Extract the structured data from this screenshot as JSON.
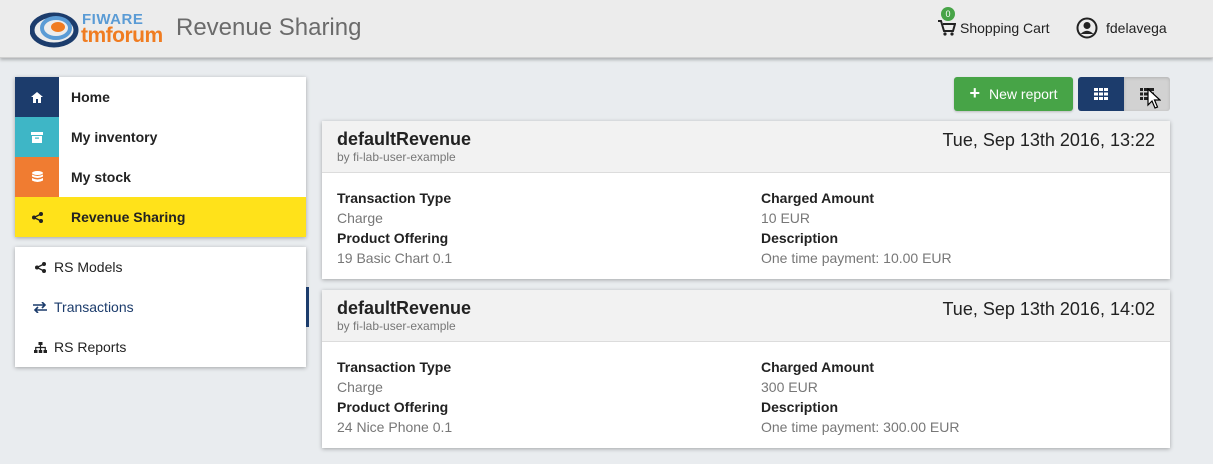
{
  "header": {
    "logo_top": "FIWARE",
    "logo_bottom": "tmforum",
    "title": "Revenue Sharing",
    "cart_count": "0",
    "cart_label": "Shopping Cart",
    "username": "fdelavega"
  },
  "sidebar": {
    "items": [
      {
        "label": "Home",
        "icon": "home-icon",
        "color": "#1c3c6c"
      },
      {
        "label": "My inventory",
        "icon": "archive-icon",
        "color": "#3eb6c6"
      },
      {
        "label": "My stock",
        "icon": "database-icon",
        "color": "#f07c31"
      },
      {
        "label": "Revenue Sharing",
        "icon": "share-icon",
        "color": "#ffe21a"
      }
    ]
  },
  "subnav": {
    "items": [
      {
        "label": "RS Models",
        "icon": "share-icon"
      },
      {
        "label": "Transactions",
        "icon": "exchange-icon"
      },
      {
        "label": "RS Reports",
        "icon": "sitemap-icon"
      }
    ]
  },
  "toolbar": {
    "new_report_label": "New report",
    "grid_view_icon": "grid-icon",
    "list_view_icon": "list-icon"
  },
  "reports": [
    {
      "title": "defaultRevenue",
      "subtitle": "by fi-lab-user-example",
      "date": "Tue, Sep 13th 2016, 13:22",
      "transaction_type_label": "Transaction Type",
      "transaction_type": "Charge",
      "product_offering_label": "Product Offering",
      "product_offering": "19 Basic Chart 0.1",
      "charged_amount_label": "Charged Amount",
      "charged_amount": "10 EUR",
      "description_label": "Description",
      "description": "One time payment: 10.00 EUR"
    },
    {
      "title": "defaultRevenue",
      "subtitle": "by fi-lab-user-example",
      "date": "Tue, Sep 13th 2016, 14:02",
      "transaction_type_label": "Transaction Type",
      "transaction_type": "Charge",
      "product_offering_label": "Product Offering",
      "product_offering": "24 Nice Phone 0.1",
      "charged_amount_label": "Charged Amount",
      "charged_amount": "300 EUR",
      "description_label": "Description",
      "description": "One time payment: 300.00 EUR"
    }
  ]
}
